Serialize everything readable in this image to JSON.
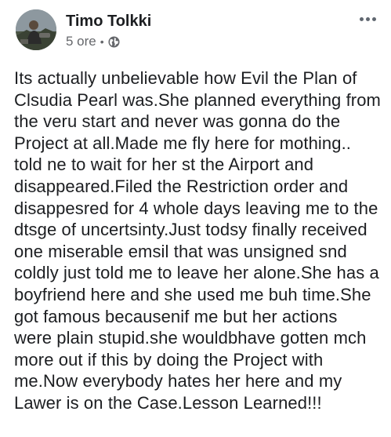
{
  "post": {
    "author": "Timo Tolkki",
    "time": "5 ore",
    "separator": "•",
    "audience_icon": "globe-icon",
    "more_icon": "more-horizontal-icon",
    "text": "Its actually unbelievable how Evil the Plan of\nClsudia Pearl was.She planned everything from\nthe veru start and never was gonna do the\nProject at all.Made me fly here for mothing..\ntold ne to wait for her st the Airport and\ndisappeared.Filed the Restriction order and\ndisappesred for 4 whole days leaving me to the\ndtsge of uncertsinty.Just todsy finally received\none miserable emsil that was unsigned snd\ncoldly just told me to leave her alone.She has a\nboyfriend here and she used me buh time.She\ngot famous becausenif me but her actions\nwere plain stupid.she wouldbhave gotten mch\nmore out if this by doing the Project with\nme.Now everybody hates her here and my\nLawer is on the Case.Lesson Learned!!!"
  },
  "colors": {
    "text": "#1c1e21",
    "meta": "#65676b",
    "icon": "#606770",
    "background": "#ffffff"
  }
}
